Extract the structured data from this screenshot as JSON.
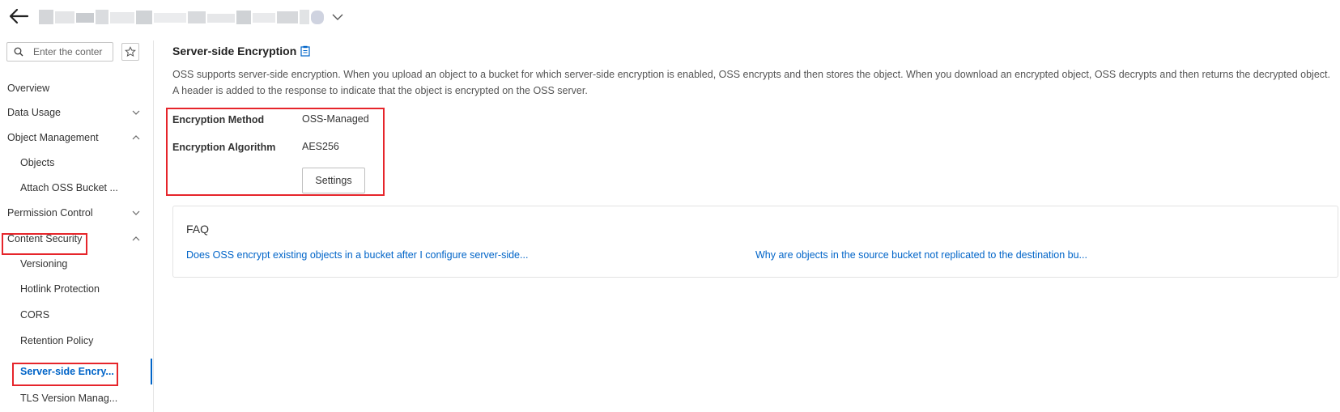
{
  "header": {
    "bucket_name": ""
  },
  "sidebar": {
    "search_placeholder": "Enter the conter",
    "items": [
      {
        "label": "Overview"
      },
      {
        "label": "Data Usage"
      },
      {
        "label": "Object Management"
      },
      {
        "label": "Objects"
      },
      {
        "label": "Attach OSS Bucket ..."
      },
      {
        "label": "Permission Control"
      },
      {
        "label": "Content Security"
      },
      {
        "label": "Versioning"
      },
      {
        "label": "Hotlink Protection"
      },
      {
        "label": "CORS"
      },
      {
        "label": "Retention Policy"
      },
      {
        "label": "Server-side Encry..."
      },
      {
        "label": "TLS Version Manag..."
      }
    ]
  },
  "main": {
    "title": "Server-side Encryption",
    "description": "OSS supports server-side encryption. When you upload an object to a bucket for which server-side encryption is enabled, OSS encrypts and then stores the object. When you download an encrypted object, OSS decrypts and then returns the decrypted object. A header is added to the response to indicate that the object is encrypted on the OSS server.",
    "fields": [
      {
        "label": "Encryption Method",
        "value": "OSS-Managed"
      },
      {
        "label": "Encryption Algorithm",
        "value": "AES256"
      }
    ],
    "settings_label": "Settings"
  },
  "faq": {
    "title": "FAQ",
    "links": [
      "Does OSS encrypt existing objects in a bucket after I configure server-side...",
      "Why are objects in the source bucket not replicated to the destination bu..."
    ]
  },
  "colors": {
    "accent": "#0064c8",
    "highlight": "#e6252b"
  }
}
